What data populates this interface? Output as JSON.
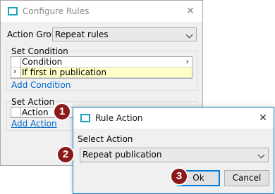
{
  "configure_rules": {
    "title": "Configure Rules",
    "action_group_label": "Action Group",
    "action_group_value": "Repeat rules",
    "set_condition": {
      "legend": "Set Condition",
      "header": "Condition",
      "row_value": "If first in publication",
      "add_link": "Add Condition"
    },
    "set_action": {
      "legend": "Set Action",
      "header": "Action",
      "add_link": "Add Action"
    }
  },
  "rule_action": {
    "title": "Rule Action",
    "select_label": "Select Action",
    "select_value": "Repeat publication",
    "ok_label": "Ok",
    "cancel_label": "Cancel"
  },
  "badges": [
    "1",
    "2",
    "3"
  ],
  "colors": {
    "badge": "#8b1a1a",
    "link": "#0066cc",
    "highlight_row": "#ffffc8",
    "dialog_border": "#1583c6"
  }
}
